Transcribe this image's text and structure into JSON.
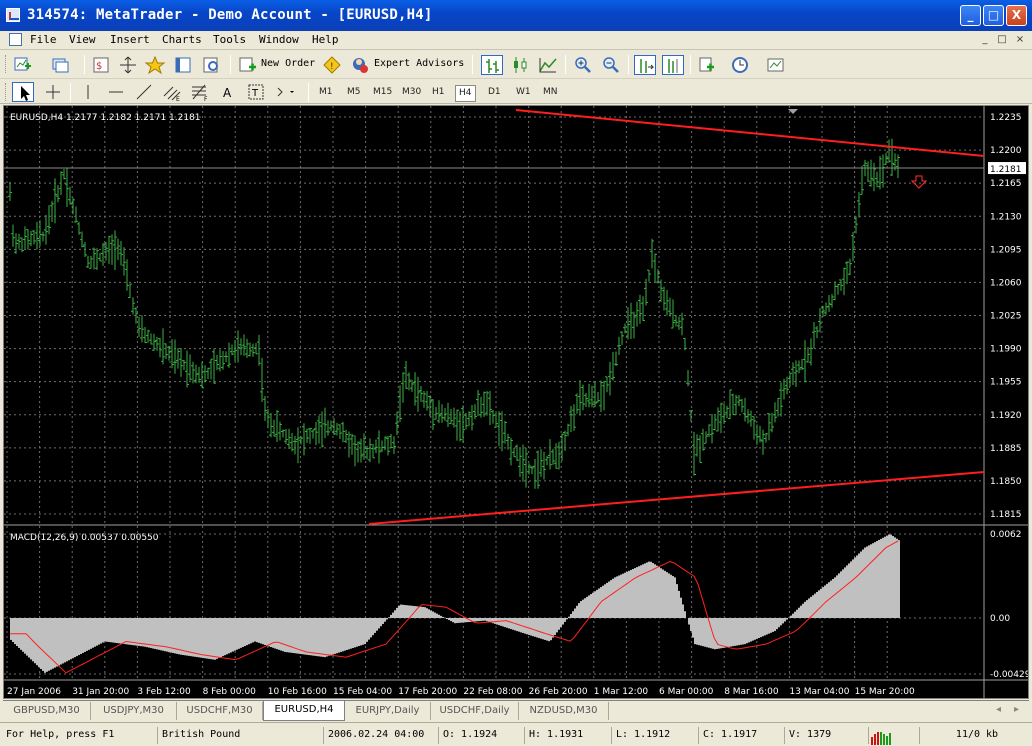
{
  "window": {
    "title": "314574: MetaTrader - Demo Account - [EURUSD,H4]",
    "controls": [
      "_",
      "□",
      "X"
    ]
  },
  "menu": [
    "File",
    "View",
    "Insert",
    "Charts",
    "Tools",
    "Window",
    "Help"
  ],
  "mdi_controls": [
    "_",
    "□",
    "×"
  ],
  "toolbar": {
    "new_order_label": "New Order",
    "expert_advisors_label": "Expert Advisors"
  },
  "timeframes": [
    "M1",
    "M5",
    "M15",
    "M30",
    "H1",
    "H4",
    "D1",
    "W1",
    "MN"
  ],
  "active_timeframe": "H4",
  "chart": {
    "header": "EURUSD,H4  1.2177 1.2182 1.2171 1.2181",
    "current_price": "1.2181",
    "price_ticks": [
      "1.2235",
      "1.2200",
      "1.2165",
      "1.2130",
      "1.2095",
      "1.2060",
      "1.2025",
      "1.1990",
      "1.1955",
      "1.1920",
      "1.1885",
      "1.1850",
      "1.1815"
    ],
    "price_range": [
      1.1815,
      1.2235
    ],
    "macd_label": "MACD(12,26,9) 0.00537 0.00550",
    "macd_ticks": [
      "0.0062",
      "0.00",
      "-0.00429"
    ],
    "date_ticks": [
      "27 Jan 2006",
      "31 Jan 20:00",
      "3 Feb 12:00",
      "8 Feb 00:00",
      "10 Feb 16:00",
      "15 Feb 04:00",
      "17 Feb 20:00",
      "22 Feb 08:00",
      "26 Feb 20:00",
      "1 Mar 12:00",
      "6 Mar 00:00",
      "8 Mar 16:00",
      "13 Mar 04:00",
      "15 Mar 20:00"
    ],
    "colors": {
      "background": "#000000",
      "bars": "#3cb043",
      "trendline": "#ff1e1e",
      "grid": "#6d6d6d",
      "histogram": "#c0c0c0",
      "signal": "#ff2020",
      "text": "#ffffff"
    }
  },
  "tabs": [
    "GBPUSD,M30",
    "USDJPY,M30",
    "USDCHF,M30",
    "EURUSD,H4",
    "EURJPY,Daily",
    "USDCHF,Daily",
    "NZDUSD,M30"
  ],
  "active_tab": "EURUSD,H4",
  "statusbar": {
    "help": "For Help, press F1",
    "profile": "British Pound",
    "time": "2006.02.24 04:00",
    "open": "O: 1.1924",
    "high": "H: 1.1931",
    "low": "L: 1.1912",
    "close": "C: 1.1917",
    "volume": "V: 1379",
    "traffic": "11/0 kb"
  }
}
